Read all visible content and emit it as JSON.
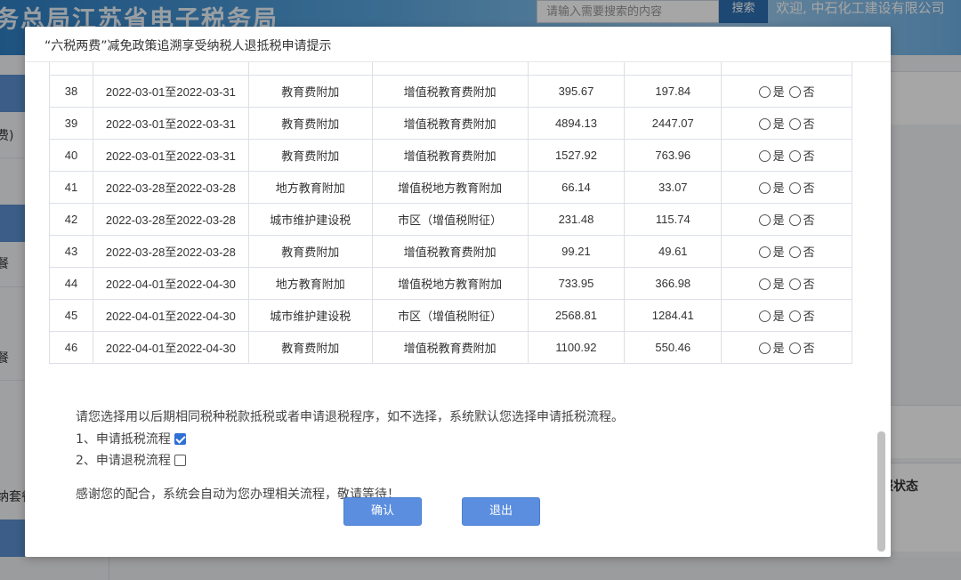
{
  "background": {
    "site_title": "务总局江苏省电子税务局",
    "search_placeholder": "请输入需要搜索的内容",
    "search_button": "搜索",
    "welcome_text": "欢迎, 中石化工建设有限公司",
    "sidebar_fragments": [
      "费)",
      "餐",
      "餐",
      "纳套餐"
    ],
    "right_status_label": "报状态"
  },
  "modal": {
    "title": "“六税两费”减免政策追溯享受纳税人退抵税申请提示",
    "table": {
      "rows": [
        {
          "no": "38",
          "period": "2022-03-01至2022-03-31",
          "tax": "教育费附加",
          "item": "增值税教育费附加",
          "amount": "395.67",
          "refund": "197.84"
        },
        {
          "no": "39",
          "period": "2022-03-01至2022-03-31",
          "tax": "教育费附加",
          "item": "增值税教育费附加",
          "amount": "4894.13",
          "refund": "2447.07"
        },
        {
          "no": "40",
          "period": "2022-03-01至2022-03-31",
          "tax": "教育费附加",
          "item": "增值税教育费附加",
          "amount": "1527.92",
          "refund": "763.96"
        },
        {
          "no": "41",
          "period": "2022-03-28至2022-03-28",
          "tax": "地方教育附加",
          "item": "增值税地方教育附加",
          "amount": "66.14",
          "refund": "33.07"
        },
        {
          "no": "42",
          "period": "2022-03-28至2022-03-28",
          "tax": "城市维护建设税",
          "item": "市区（增值税附征）",
          "amount": "231.48",
          "refund": "115.74"
        },
        {
          "no": "43",
          "period": "2022-03-28至2022-03-28",
          "tax": "教育费附加",
          "item": "增值税教育费附加",
          "amount": "99.21",
          "refund": "49.61"
        },
        {
          "no": "44",
          "period": "2022-04-01至2022-04-30",
          "tax": "地方教育附加",
          "item": "增值税地方教育附加",
          "amount": "733.95",
          "refund": "366.98"
        },
        {
          "no": "45",
          "period": "2022-04-01至2022-04-30",
          "tax": "城市维护建设税",
          "item": "市区（增值税附征）",
          "amount": "2568.81",
          "refund": "1284.41"
        },
        {
          "no": "46",
          "period": "2022-04-01至2022-04-30",
          "tax": "教育费附加",
          "item": "增值税教育费附加",
          "amount": "1100.92",
          "refund": "550.46"
        }
      ],
      "yes_label": "是",
      "no_label": "否"
    },
    "instruction": "请您选择用以后期相同税种税款抵税或者申请退税程序，如不选择，系统默认您选择申请抵税流程。",
    "option1": {
      "label": "1、申请抵税流程",
      "checked": true
    },
    "option2": {
      "label": "2、申请退税流程",
      "checked": false
    },
    "thanks": "感谢您的配合，系统会自动为您办理相关流程，敬请等待！",
    "confirm_button": "确认",
    "exit_button": "退出"
  }
}
